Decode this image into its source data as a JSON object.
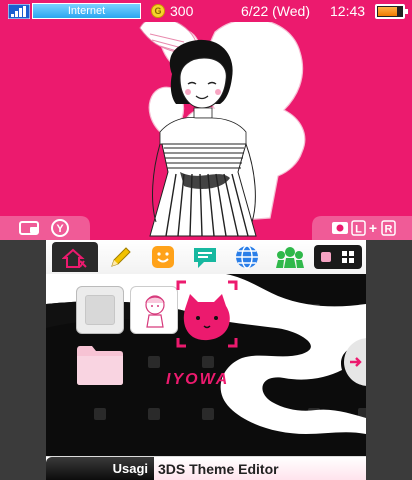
{
  "status_bar": {
    "wifi_label": "Internet",
    "coin_icon_glyph": "G",
    "coins": "300",
    "date": "6/22 (Wed)",
    "time": "12:43",
    "battery_level": 0.8
  },
  "top_screen": {
    "background_color": "#ec1a6e",
    "camera_left_button": "Y",
    "camera_right_buttons": [
      "L",
      "+",
      "R"
    ]
  },
  "bottom_screen": {
    "toolbar_icons": [
      "home-settings-icon",
      "pencil-icon",
      "smiley-icon",
      "chat-icon",
      "globe-icon",
      "friends-icon"
    ],
    "view_icons": [
      "single-view-icon",
      "grid-view-icon"
    ],
    "art_text": "IYOWA",
    "footer": {
      "author": "Usagi",
      "title": "3DS Theme Editor"
    }
  },
  "colors": {
    "accent_pink": "#ec1a6e",
    "toolbar_bg": "#f2f2f2",
    "bottom_bg": "#0c0c0c"
  }
}
